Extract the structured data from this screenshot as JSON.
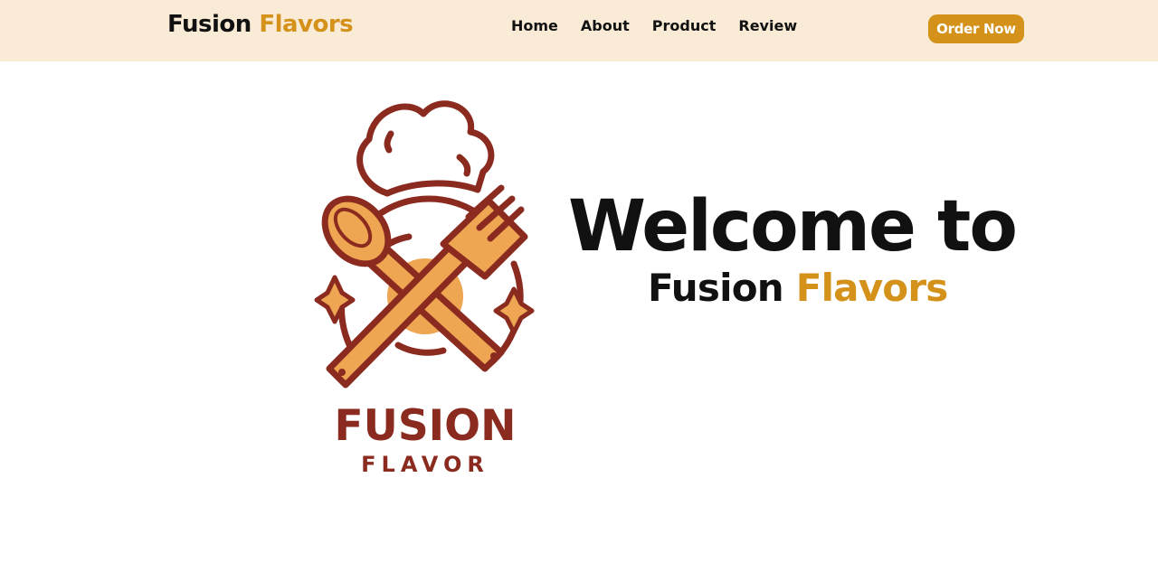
{
  "header": {
    "brand_main": "Fusion",
    "brand_accent": "Flavors",
    "nav": [
      "Home",
      "About",
      "Product",
      "Review"
    ],
    "cta_label": "Order Now"
  },
  "hero": {
    "logo": {
      "icon": "chef-hat-spoon-fork-icon",
      "wordmark_top": "FUSION",
      "wordmark_bottom": "FLAVOR"
    },
    "heading": "Welcome to",
    "sub_main": "Fusion",
    "sub_accent": "Flavors"
  },
  "colors": {
    "nav_bg": "#faebd7",
    "accent": "#d4921a",
    "logo_dark": "#8b2b20",
    "logo_orange": "#eea652"
  }
}
